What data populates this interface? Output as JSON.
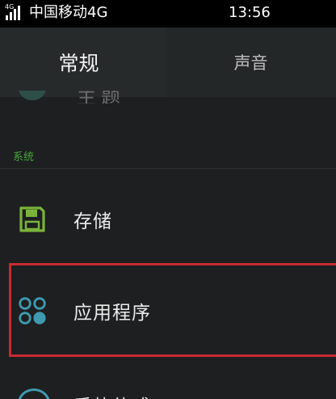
{
  "status_bar": {
    "network_type": "4G",
    "carrier": "中国移动4G",
    "time": "13:56"
  },
  "tabs": [
    {
      "label": "常规",
      "selected": true
    },
    {
      "label": "声音",
      "selected": false
    }
  ],
  "partial_item_above": {
    "label": "主题"
  },
  "section": {
    "header": "系统",
    "items": [
      {
        "label": "存储",
        "icon": "storage-icon"
      },
      {
        "label": "应用程序",
        "icon": "apps-icon",
        "highlighted": true
      }
    ],
    "partial_item_below": {
      "label": "手势体感"
    }
  },
  "colors": {
    "background": "#1d1f20",
    "section_header": "#47a63a",
    "highlight": "#c92a33",
    "storage_icon": "#7bb33a",
    "apps_icon": "#3f9ab0"
  }
}
